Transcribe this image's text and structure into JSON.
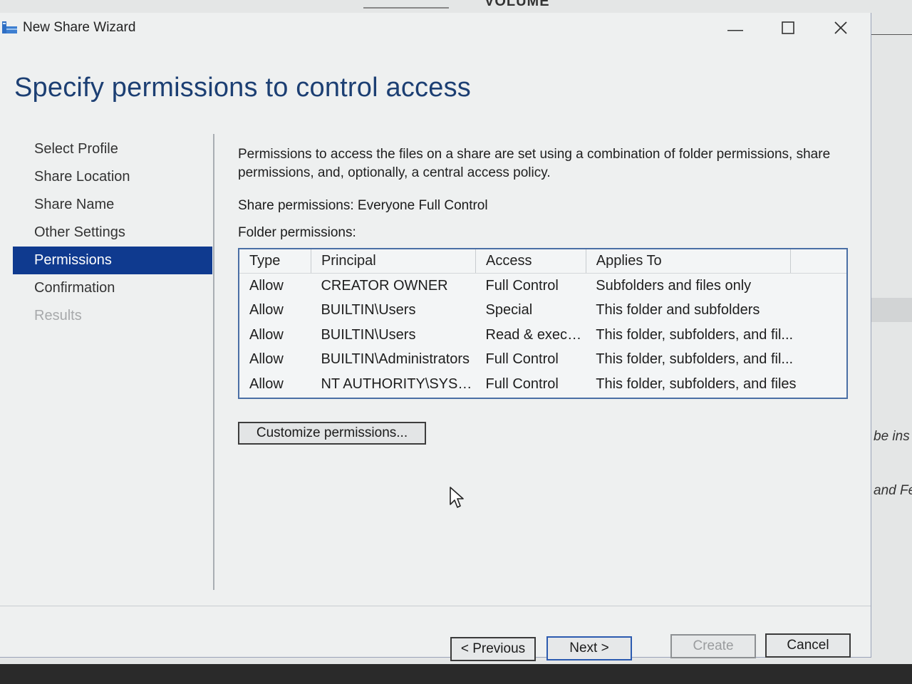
{
  "background": {
    "volume_header": "VOLUME",
    "side_text_1": "be ins",
    "side_text_2": "and Fe"
  },
  "window": {
    "title": "New Share Wizard",
    "icon": "share-wizard-icon",
    "controls": [
      "minimize-icon",
      "maximize-icon",
      "close-icon"
    ]
  },
  "page": {
    "heading": "Specify permissions to control access"
  },
  "nav": {
    "items": [
      {
        "label": "Select Profile",
        "state": "normal"
      },
      {
        "label": "Share Location",
        "state": "normal"
      },
      {
        "label": "Share Name",
        "state": "normal"
      },
      {
        "label": "Other Settings",
        "state": "normal"
      },
      {
        "label": "Permissions",
        "state": "active"
      },
      {
        "label": "Confirmation",
        "state": "normal"
      },
      {
        "label": "Results",
        "state": "disabled"
      }
    ]
  },
  "content": {
    "description": "Permissions to access the files on a share are set using a combination of folder permissions, share permissions, and, optionally, a central access policy.",
    "share_permissions": "Share permissions:  Everyone Full Control",
    "folder_permissions_label": "Folder permissions:",
    "table": {
      "columns": [
        "Type",
        "Principal",
        "Access",
        "Applies To"
      ],
      "rows": [
        [
          "Allow",
          "CREATOR OWNER",
          "Full Control",
          "Subfolders and files only"
        ],
        [
          "Allow",
          "BUILTIN\\Users",
          "Special",
          "This folder and subfolders"
        ],
        [
          "Allow",
          "BUILTIN\\Users",
          "Read & execute",
          "This folder, subfolders, and fil..."
        ],
        [
          "Allow",
          "BUILTIN\\Administrators",
          "Full Control",
          "This folder, subfolders, and fil..."
        ],
        [
          "Allow",
          "NT AUTHORITY\\SYSTEM",
          "Full Control",
          "This folder, subfolders, and files"
        ]
      ]
    },
    "customize_button": "Customize permissions..."
  },
  "footer": {
    "previous": "< Previous",
    "next": "Next >",
    "create": "Create",
    "cancel": "Cancel"
  },
  "colors": {
    "heading": "#1c3f73",
    "nav_active_bg": "#0f3a8f",
    "table_border": "#4a6fa5"
  }
}
